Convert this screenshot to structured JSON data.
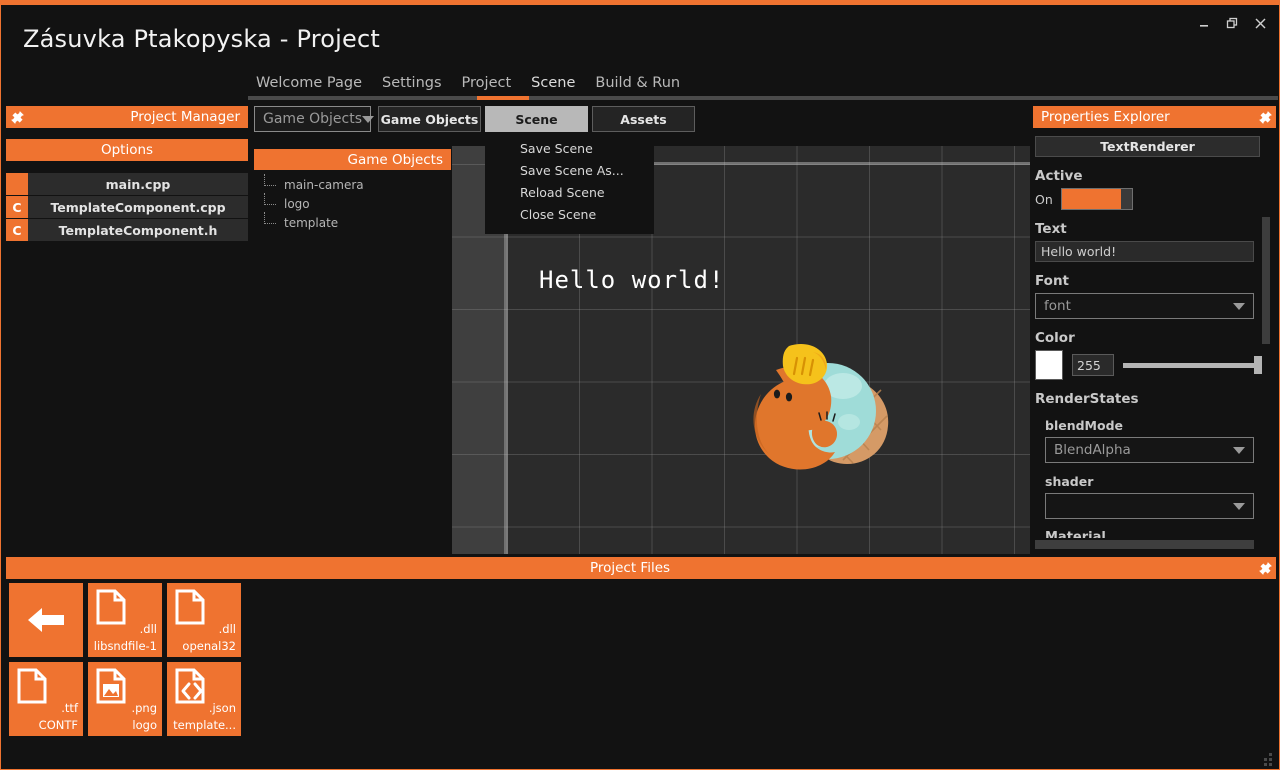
{
  "window": {
    "title": "Zásuvka Ptakopyska - Project",
    "minimize_label": "Minimize",
    "maximize_label": "Restore",
    "close_label": "Close"
  },
  "menubar": {
    "items": [
      {
        "label": "Welcome Page",
        "active": false
      },
      {
        "label": "Settings",
        "active": false
      },
      {
        "label": "Project",
        "active": false
      },
      {
        "label": "Scene",
        "active": true
      },
      {
        "label": "Build & Run",
        "active": false
      }
    ],
    "accent": "#ef7330"
  },
  "project_manager": {
    "title": "Project Manager",
    "options_label": "Options",
    "files": [
      {
        "badge": "",
        "name": "main.cpp"
      },
      {
        "badge": "C",
        "name": "TemplateComponent.cpp"
      },
      {
        "badge": "C",
        "name": "TemplateComponent.h"
      }
    ]
  },
  "game_objects": {
    "dropdown_value": "Game Objects",
    "header_label": "Game Objects",
    "nodes": [
      {
        "label": "main-camera"
      },
      {
        "label": "logo"
      },
      {
        "label": "template"
      }
    ]
  },
  "scene_tabs": [
    {
      "label": "Game Objects",
      "active": false
    },
    {
      "label": "Scene",
      "active": true
    },
    {
      "label": "Assets",
      "active": false
    }
  ],
  "scene_menu": {
    "items": [
      {
        "label": "Save Scene"
      },
      {
        "label": "Save Scene As..."
      },
      {
        "label": "Reload Scene"
      },
      {
        "label": "Close Scene"
      }
    ]
  },
  "viewport": {
    "scene_text": "Hello world!",
    "logo_name": "platypus-logo"
  },
  "properties": {
    "title": "Properties Explorer",
    "component": "TextRenderer",
    "active_label": "Active",
    "active_state": "On",
    "text_label": "Text",
    "text_value": "Hello world!",
    "font_label": "Font",
    "font_value": "font",
    "color_label": "Color",
    "color_swatch": "#ffffff",
    "color_value": "255",
    "render_states_label": "RenderStates",
    "blend_mode_label": "blendMode",
    "blend_mode_value": "BlendAlpha",
    "shader_label": "shader",
    "shader_value": "",
    "cut_off_label": "Material"
  },
  "project_files": {
    "title": "Project Files",
    "tiles": [
      {
        "icon": "back-arrow-icon",
        "ext": "",
        "name": ""
      },
      {
        "icon": "file-icon",
        "ext": ".dll",
        "name": "libsndfile-1"
      },
      {
        "icon": "file-icon",
        "ext": ".dll",
        "name": "openal32"
      },
      {
        "icon": "file-icon",
        "ext": ".ttf",
        "name": "CONTF"
      },
      {
        "icon": "image-file-icon",
        "ext": ".png",
        "name": "logo"
      },
      {
        "icon": "code-file-icon",
        "ext": ".json",
        "name": "template..."
      }
    ]
  }
}
